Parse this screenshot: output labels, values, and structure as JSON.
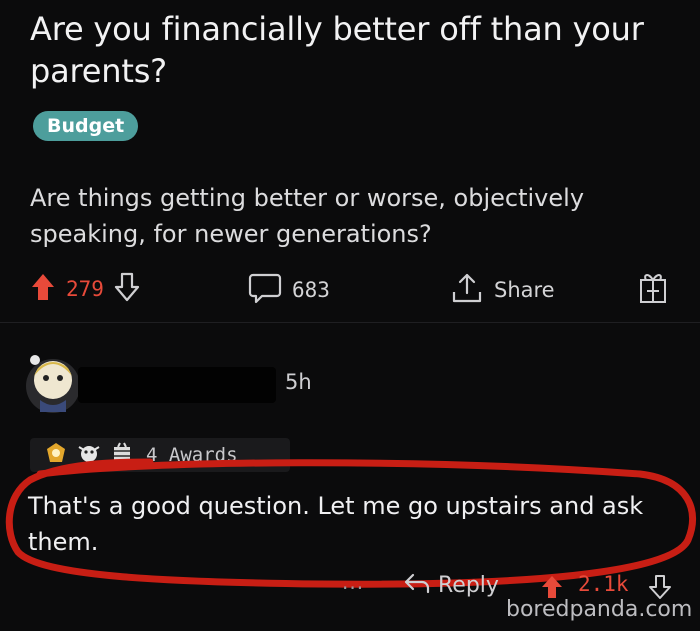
{
  "post": {
    "title": "Are you financially better off than your parents?",
    "flair": "Budget",
    "body": "Are things getting better or worse, objectively speaking, for newer generations?"
  },
  "actions": {
    "upvotes": "279",
    "comments": "683",
    "share_label": "Share"
  },
  "comment": {
    "age": "5h",
    "awards_label": "4 Awards",
    "text": "That's a good question. Let me go upstairs and ask them.",
    "more": "...",
    "reply_label": "Reply",
    "votes": "2.1k"
  },
  "watermark": "boredpanda.com",
  "colors": {
    "background": "#0b0b0c",
    "upvote": "#e84a3a",
    "flair": "#4d9e9c",
    "annotation_circle": "#c81e14"
  },
  "icons": [
    "upvote-icon",
    "downvote-icon",
    "comment-icon",
    "share-icon",
    "gift-icon",
    "reply-icon"
  ]
}
